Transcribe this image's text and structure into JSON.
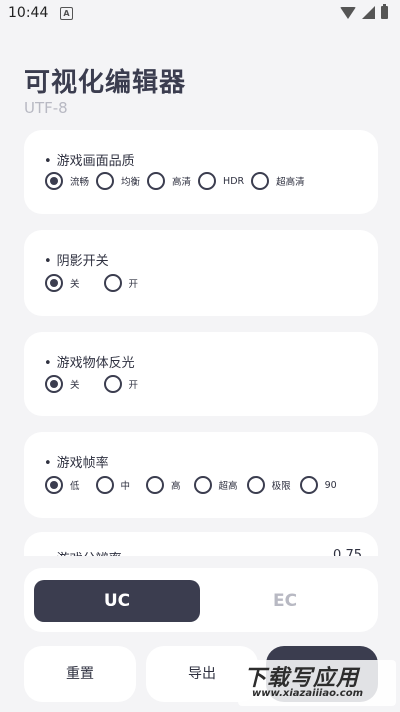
{
  "status_bar": {
    "time": "10:44",
    "notification_glyph": "A"
  },
  "header": {
    "title": "可视化编辑器",
    "subtitle": "UTF-8"
  },
  "sections": [
    {
      "title": "游戏画面品质",
      "options": [
        "流畅",
        "均衡",
        "高清",
        "HDR",
        "超高清"
      ],
      "selected": 0
    },
    {
      "title": "阴影开关",
      "options": [
        "关",
        "开"
      ],
      "selected": 0
    },
    {
      "title": "游戏物体反光",
      "options": [
        "关",
        "开"
      ],
      "selected": 0
    },
    {
      "title": "游戏帧率",
      "options": [
        "低",
        "中",
        "高",
        "超高",
        "极限",
        "90"
      ],
      "selected": 0
    },
    {
      "title": "游戏分辨率",
      "value": "0.75"
    }
  ],
  "segment": {
    "uc_label": "UC",
    "ec_label": "EC",
    "selected": "UC"
  },
  "actions": {
    "reset_label": "重置",
    "export_label": "导出"
  },
  "watermark": {
    "main": "下载写应用",
    "sub": "www.xiazaiiiao.com"
  }
}
